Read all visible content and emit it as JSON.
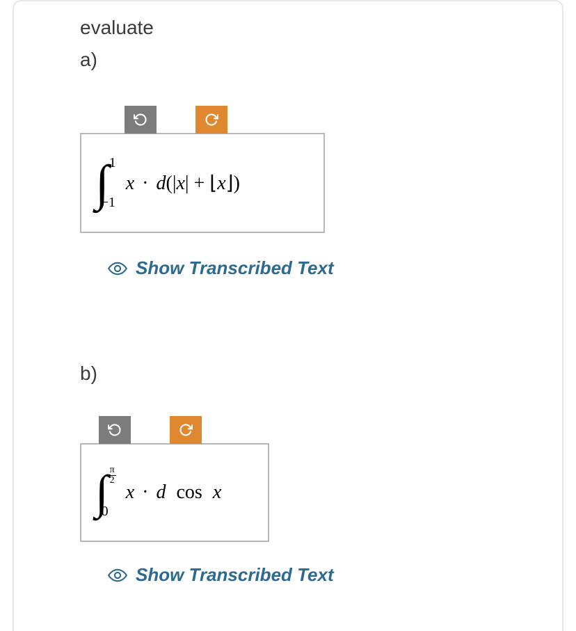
{
  "instruction": "evaluate",
  "parts": {
    "a": {
      "label": "a)",
      "integral": {
        "upper_bound": "1",
        "lower_bound": "−1",
        "integrand_latex": "x · d(|x| + ⌊x⌋)"
      },
      "show_link": "Show Transcribed Text"
    },
    "b": {
      "label": "b)",
      "integral": {
        "upper_bound_frac_top": "π",
        "upper_bound_frac_bot": "2",
        "lower_bound": "0",
        "integrand_latex": "x · d cos x"
      },
      "show_link": "Show Transcribed Text"
    }
  },
  "icons": {
    "rotate_ccw": "rotate-ccw",
    "rotate_cw": "rotate-cw",
    "eye": "eye"
  }
}
